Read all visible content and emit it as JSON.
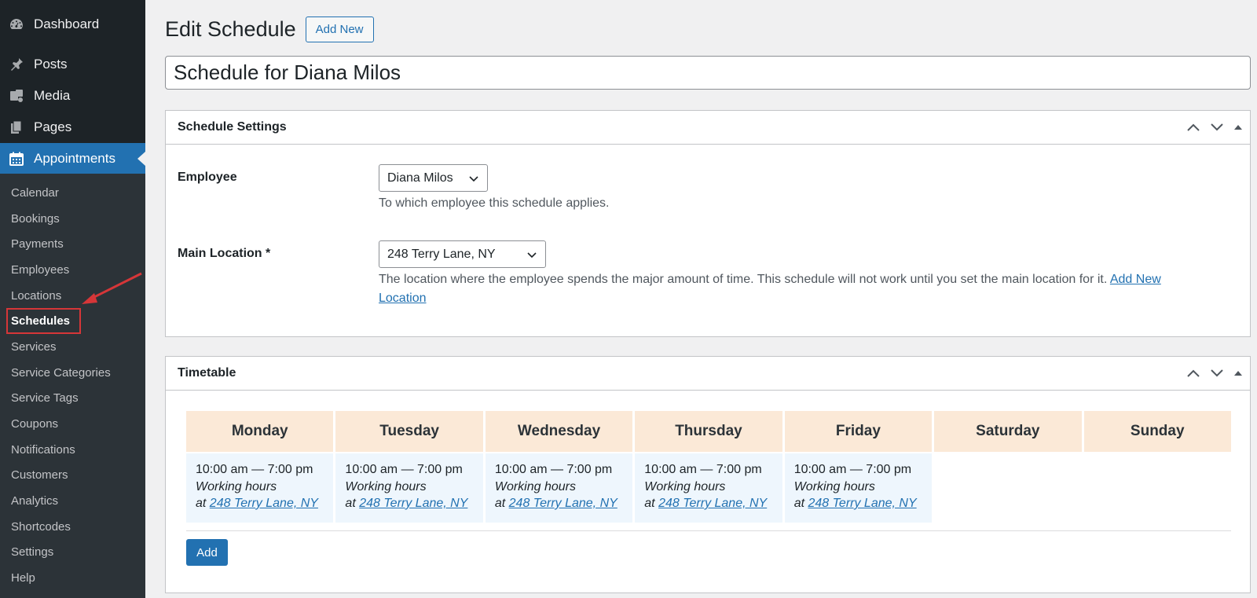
{
  "sidebar": {
    "top_items": [
      {
        "label": "Dashboard",
        "icon": "dashboard-icon"
      },
      {
        "label": "Posts",
        "icon": "pin-icon"
      },
      {
        "label": "Media",
        "icon": "media-icon"
      },
      {
        "label": "Pages",
        "icon": "pages-icon"
      },
      {
        "label": "Appointments",
        "icon": "calendar-icon"
      }
    ],
    "submenu": [
      "Calendar",
      "Bookings",
      "Payments",
      "Employees",
      "Locations",
      "Schedules",
      "Services",
      "Service Categories",
      "Service Tags",
      "Coupons",
      "Notifications",
      "Customers",
      "Analytics",
      "Shortcodes",
      "Settings",
      "Help"
    ],
    "current_submenu": "Schedules"
  },
  "page": {
    "title": "Edit Schedule",
    "add_new_label": "Add New",
    "post_title": "Schedule for Diana Milos"
  },
  "settings_box": {
    "title": "Schedule Settings",
    "employee_label": "Employee",
    "employee_value": "Diana Milos",
    "employee_desc": "To which employee this schedule applies.",
    "location_label": "Main Location *",
    "location_value": "248 Terry Lane, NY",
    "location_desc": "The location where the employee spends the major amount of time. This schedule will not work until you set the main location for it.",
    "location_link_1": "Add New",
    "location_link_2": "Location"
  },
  "timetable_box": {
    "title": "Timetable",
    "days": [
      {
        "day": "Monday",
        "time": "10:00 am — 7:00 pm",
        "type": "Working hours",
        "at": "at",
        "location": "248 Terry Lane, NY"
      },
      {
        "day": "Tuesday",
        "time": "10:00 am — 7:00 pm",
        "type": "Working hours",
        "at": "at",
        "location": "248 Terry Lane, NY"
      },
      {
        "day": "Wednesday",
        "time": "10:00 am — 7:00 pm",
        "type": "Working hours",
        "at": "at",
        "location": "248 Terry Lane, NY"
      },
      {
        "day": "Thursday",
        "time": "10:00 am — 7:00 pm",
        "type": "Working hours",
        "at": "at",
        "location": "248 Terry Lane, NY"
      },
      {
        "day": "Friday",
        "time": "10:00 am — 7:00 pm",
        "type": "Working hours",
        "at": "at",
        "location": "248 Terry Lane, NY"
      },
      {
        "day": "Saturday"
      },
      {
        "day": "Sunday"
      }
    ],
    "add_label": "Add"
  },
  "colors": {
    "accent": "#2271b1",
    "sidebar_bg": "#1d2327",
    "day_header_bg": "#fbe9d7",
    "cell_bg": "#eef6fd",
    "annotation_red": "#d63638"
  }
}
